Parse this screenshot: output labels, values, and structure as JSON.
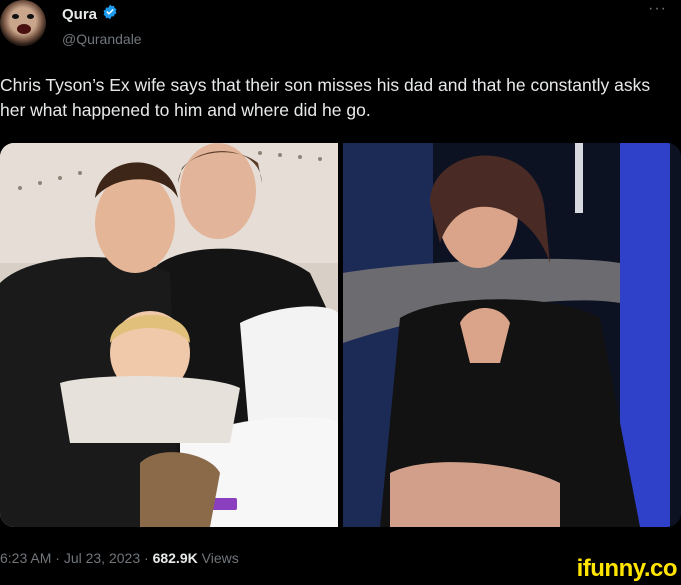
{
  "author": {
    "name": "Qura",
    "handle": "@Qurandale",
    "verified_icon": "verified-badge-icon",
    "verified_color": "#1d9bf0"
  },
  "more_icon": "more-options-icon",
  "more_label": "···",
  "tweet": {
    "text": "Chris Tyson’s Ex wife says that their son misses his dad and that he constantly asks her what happened to him and where did he go."
  },
  "media": {
    "left_pillow_label": "purple"
  },
  "meta": {
    "time": "6:23 AM",
    "sep1": " · ",
    "date": "Jul 23, 2023",
    "sep2": " · ",
    "views_count": "682.9K",
    "views_label": " Views"
  },
  "watermark": "ifunny.co"
}
